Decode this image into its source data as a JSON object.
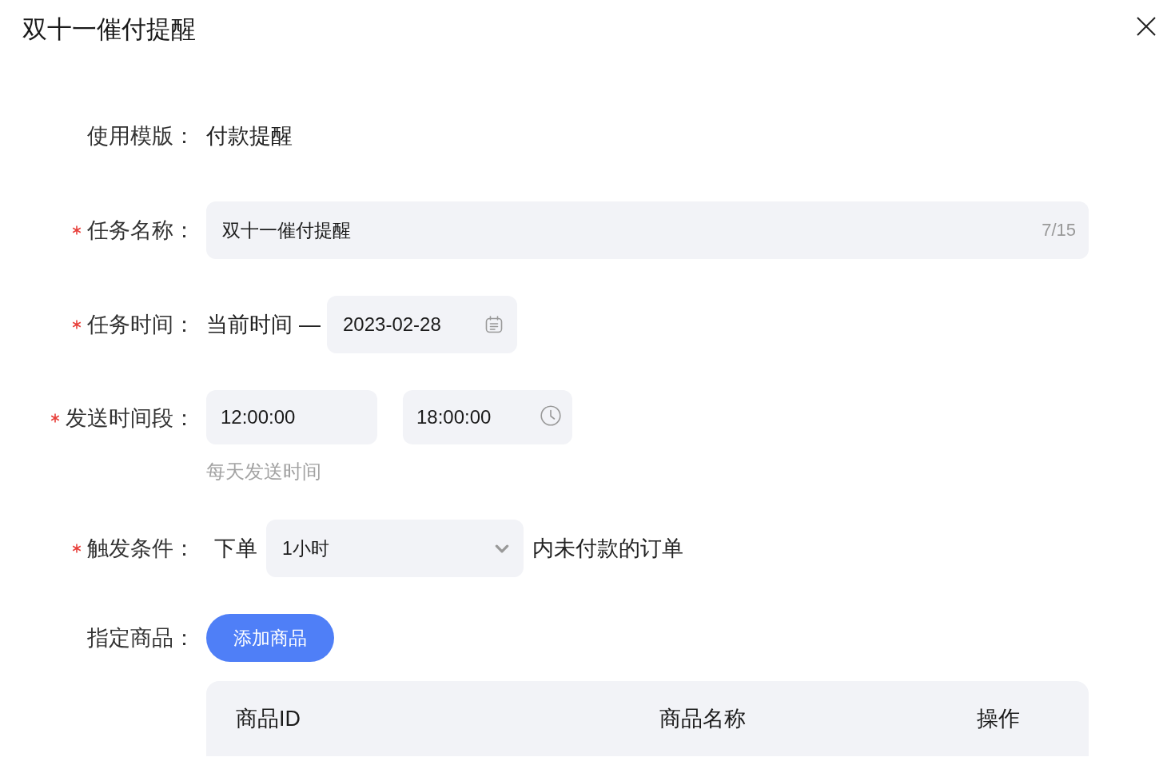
{
  "dialog": {
    "title": "双十一催付提醒"
  },
  "form": {
    "fields": [
      {
        "kind": "static",
        "label": "使用模版：",
        "required": false,
        "value": "付款提醒"
      },
      {
        "kind": "text",
        "label": "任务名称：",
        "required": true,
        "value": "双十一催付提醒",
        "counter": "7/15"
      },
      {
        "kind": "date_range",
        "label": "任务时间：",
        "required": true,
        "start": "当前时间",
        "separator": "—",
        "end": "2023-02-28"
      },
      {
        "kind": "time_range",
        "label": "发送时间段：",
        "required": true,
        "start": "12:00:00",
        "end": "18:00:00",
        "hint": "每天发送时间"
      },
      {
        "kind": "condition",
        "label": "触发条件：",
        "required": true,
        "prefix": "下单",
        "value": "1小时",
        "suffix": "内未付款的订单"
      },
      {
        "kind": "products",
        "label": "指定商品：",
        "required": false,
        "button": "添加商品",
        "columns": [
          "商品ID",
          "商品名称",
          "操作"
        ]
      }
    ]
  }
}
